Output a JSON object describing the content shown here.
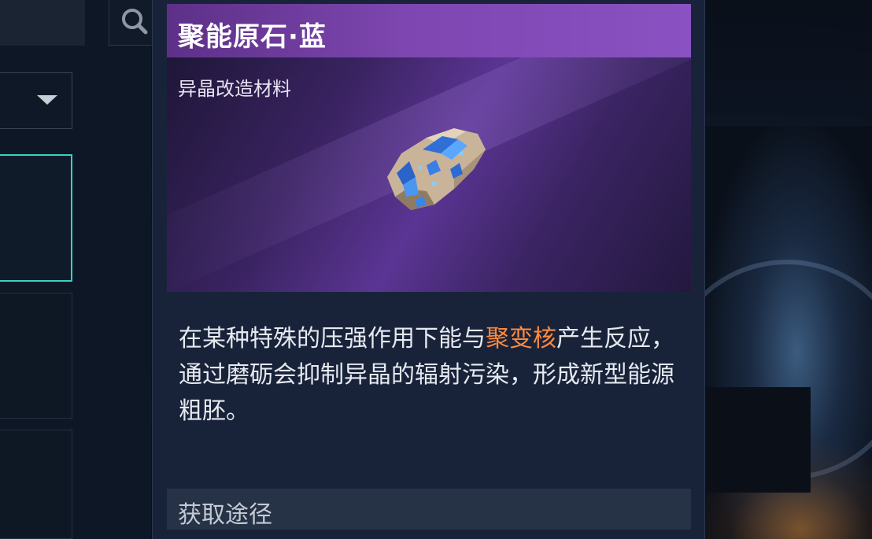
{
  "item": {
    "title": "聚能原石·蓝",
    "category": "异晶改造材料",
    "description": {
      "part1": "在某种特殊的压强作用下能与",
      "highlight": "聚变核",
      "part2": "产生反应，通过磨砺会抑制异晶的辐射污染，形成新型能源粗胚。"
    },
    "acquisition_label": "获取途径"
  },
  "icons": {
    "search": "search-icon",
    "dropdown": "chevron-down-icon",
    "item_art": "blue-crystal-ore-icon"
  },
  "colors": {
    "title_bar": "#7d46b0",
    "highlight": "#ff8a3d",
    "selected_border": "#3ad1c2",
    "panel_bg": "#18233a"
  }
}
